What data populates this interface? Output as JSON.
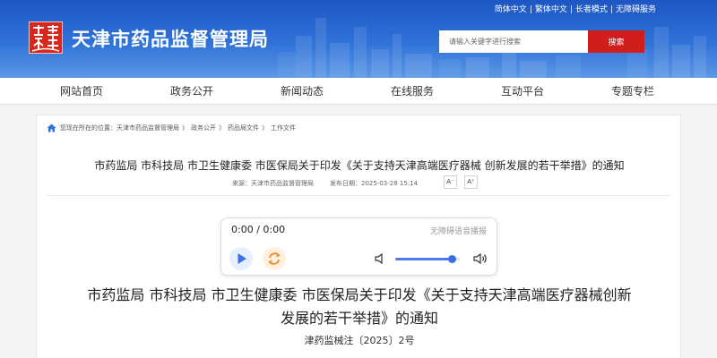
{
  "header": {
    "site_title": "天津市药品监督管理局",
    "logo_icon": "tianjin-emblem-icon",
    "top_links": [
      "简体中文",
      "繁体中文",
      "长者模式",
      "无障碍服务"
    ],
    "top_link_separator": "|",
    "search": {
      "placeholder": "请输入关键字进行搜索",
      "button_label": "搜索"
    },
    "colors": {
      "header_blue": "#2f72d8",
      "search_red": "#d21d1d",
      "logo_red": "#d8271c"
    }
  },
  "nav": {
    "items": [
      "网站首页",
      "政务公开",
      "新闻动态",
      "在线服务",
      "互动平台",
      "专题专栏"
    ]
  },
  "breadcrumb": {
    "prefix": "您现在所在的位置：",
    "items": [
      "天津市药品监督管理局",
      "政务公开",
      "药品局文件",
      "工作文件"
    ],
    "separator": "》"
  },
  "article": {
    "title": "市药监局 市科技局 市卫生健康委 市医保局关于印发《关于支持天津高端医疗器械 创新发展的若干举措》的通知",
    "source_label": "来源：",
    "source_value": "天津市药品监督管理局",
    "date_label": "发布日期：",
    "date_value": "2025-03-28 15:14",
    "font_decrease_label": "A⁻",
    "font_increase_label": "A⁺",
    "body_title_line1": "市药监局 市科技局 市卫生健康委 市医保局关于印发《关于支持天津高端医疗器械创新",
    "body_title_line2": "发展的若干举措》的通知",
    "doc_number": "津药监械注〔2025〕2号"
  },
  "player": {
    "time_text": "0:00 / 0:00",
    "accessibility_label": "无障碍语音播报",
    "volume_fraction": 0.88,
    "colors": {
      "play_blue": "#3b6fe8",
      "loop_orange": "#f08c2a"
    }
  }
}
